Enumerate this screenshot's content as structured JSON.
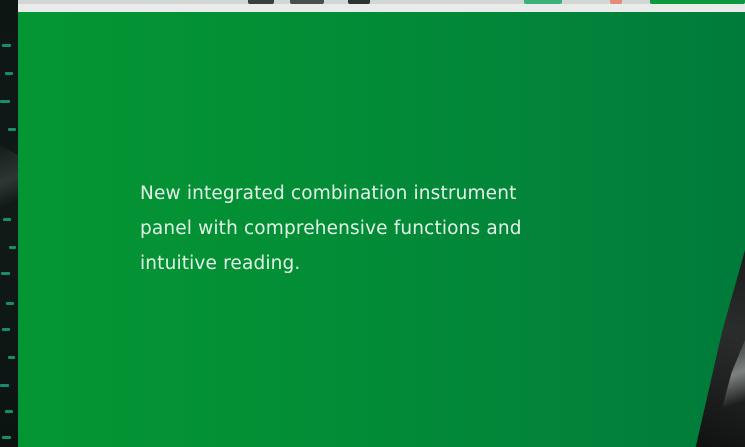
{
  "panel": {
    "description": "New integrated combination instrument panel with comprehensive functions and intuitive reading."
  },
  "colors": {
    "panel_green_start": "#049634",
    "panel_green_end": "#007b3a",
    "text": "#e4f3e8",
    "accent_dash": "#1db38f"
  }
}
